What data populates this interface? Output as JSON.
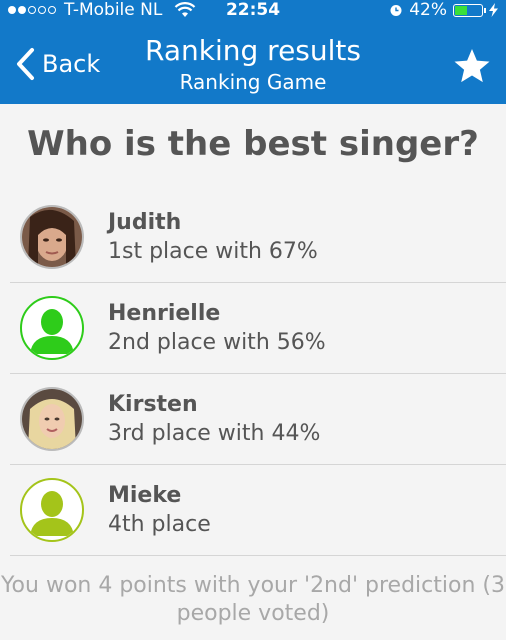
{
  "status_bar": {
    "carrier": "T-Mobile NL",
    "time": "22:54",
    "battery_percent": "42%",
    "battery_level": 0.42,
    "signal_bars_filled": 2,
    "signal_bars_total": 5
  },
  "nav": {
    "back_label": "Back",
    "title": "Ranking results",
    "subtitle": "Ranking Game",
    "star_icon": "star-icon"
  },
  "question": "Who is the best singer?",
  "results": [
    {
      "name": "Judith",
      "rank_text": "1st place with 67%",
      "avatar": "photo"
    },
    {
      "name": "Henrielle",
      "rank_text": "2nd place with 56%",
      "avatar": "placeholder",
      "avatar_color": "#2ecc1a"
    },
    {
      "name": "Kirsten",
      "rank_text": "3rd place with 44%",
      "avatar": "photo"
    },
    {
      "name": "Mieke",
      "rank_text": "4th place",
      "avatar": "placeholder",
      "avatar_color": "#a4c41a"
    }
  ],
  "footer_text": "You won 4 points with your '2nd' prediction (3 people voted)",
  "colors": {
    "header": "#1279c9",
    "background": "#f4f4f4",
    "text": "#555555",
    "footer_text": "#a8a8a8"
  }
}
